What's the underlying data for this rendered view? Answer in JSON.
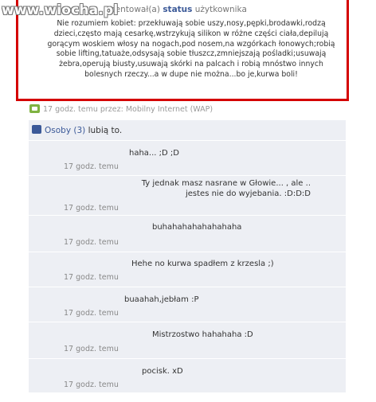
{
  "watermark": "www.wiocha.pl",
  "post": {
    "action_text": "pentował(a)",
    "action_link": "status",
    "action_suffix": "użytkownika",
    "body": "Nie rozumiem kobiet: przekłuwają sobie uszy,nosy,pępki,brodawki,rodzą dzieci,często mają cesarkę,wstrzykują silikon w różne części ciała,depilują gorącym woskiem włosy na nogach,pod nosem,na wzgórkach łonowych;robią sobie lifting,tatuaże,odsysają sobie tłuszcz,zmniejszają pośladki;usuwają żebra,operują biusty,usuwają skórki na palcach i robią mnóstwo innych bolesnych rzeczy...a w dupe nie można...bo je,kurwa boli!",
    "meta": "17 godz. temu przez: Mobilny Internet (WAP)"
  },
  "likes": {
    "link": "Osoby (3)",
    "suffix": " lubią to."
  },
  "comments": [
    {
      "text": "haha... ;D ;D",
      "time": "17 godz. temu"
    },
    {
      "text": "Ty jednak masz nasrane w Głowie... , ale ..\njestes nie do wyjebania. :D:D:D",
      "time": "17 godz. temu"
    },
    {
      "text": "buhahahahahahahaha",
      "time": "17 godz. temu"
    },
    {
      "text": "Hehe no kurwa spadłem z krzesla ;)",
      "time": "17 godz. temu"
    },
    {
      "text": "buaahah,jebłam :P",
      "time": "17 godz. temu"
    },
    {
      "text": "Mistrzostwo hahahaha :D",
      "time": "17 godz. temu"
    },
    {
      "text": "pocisk. xD",
      "time": "17 godz. temu"
    }
  ]
}
